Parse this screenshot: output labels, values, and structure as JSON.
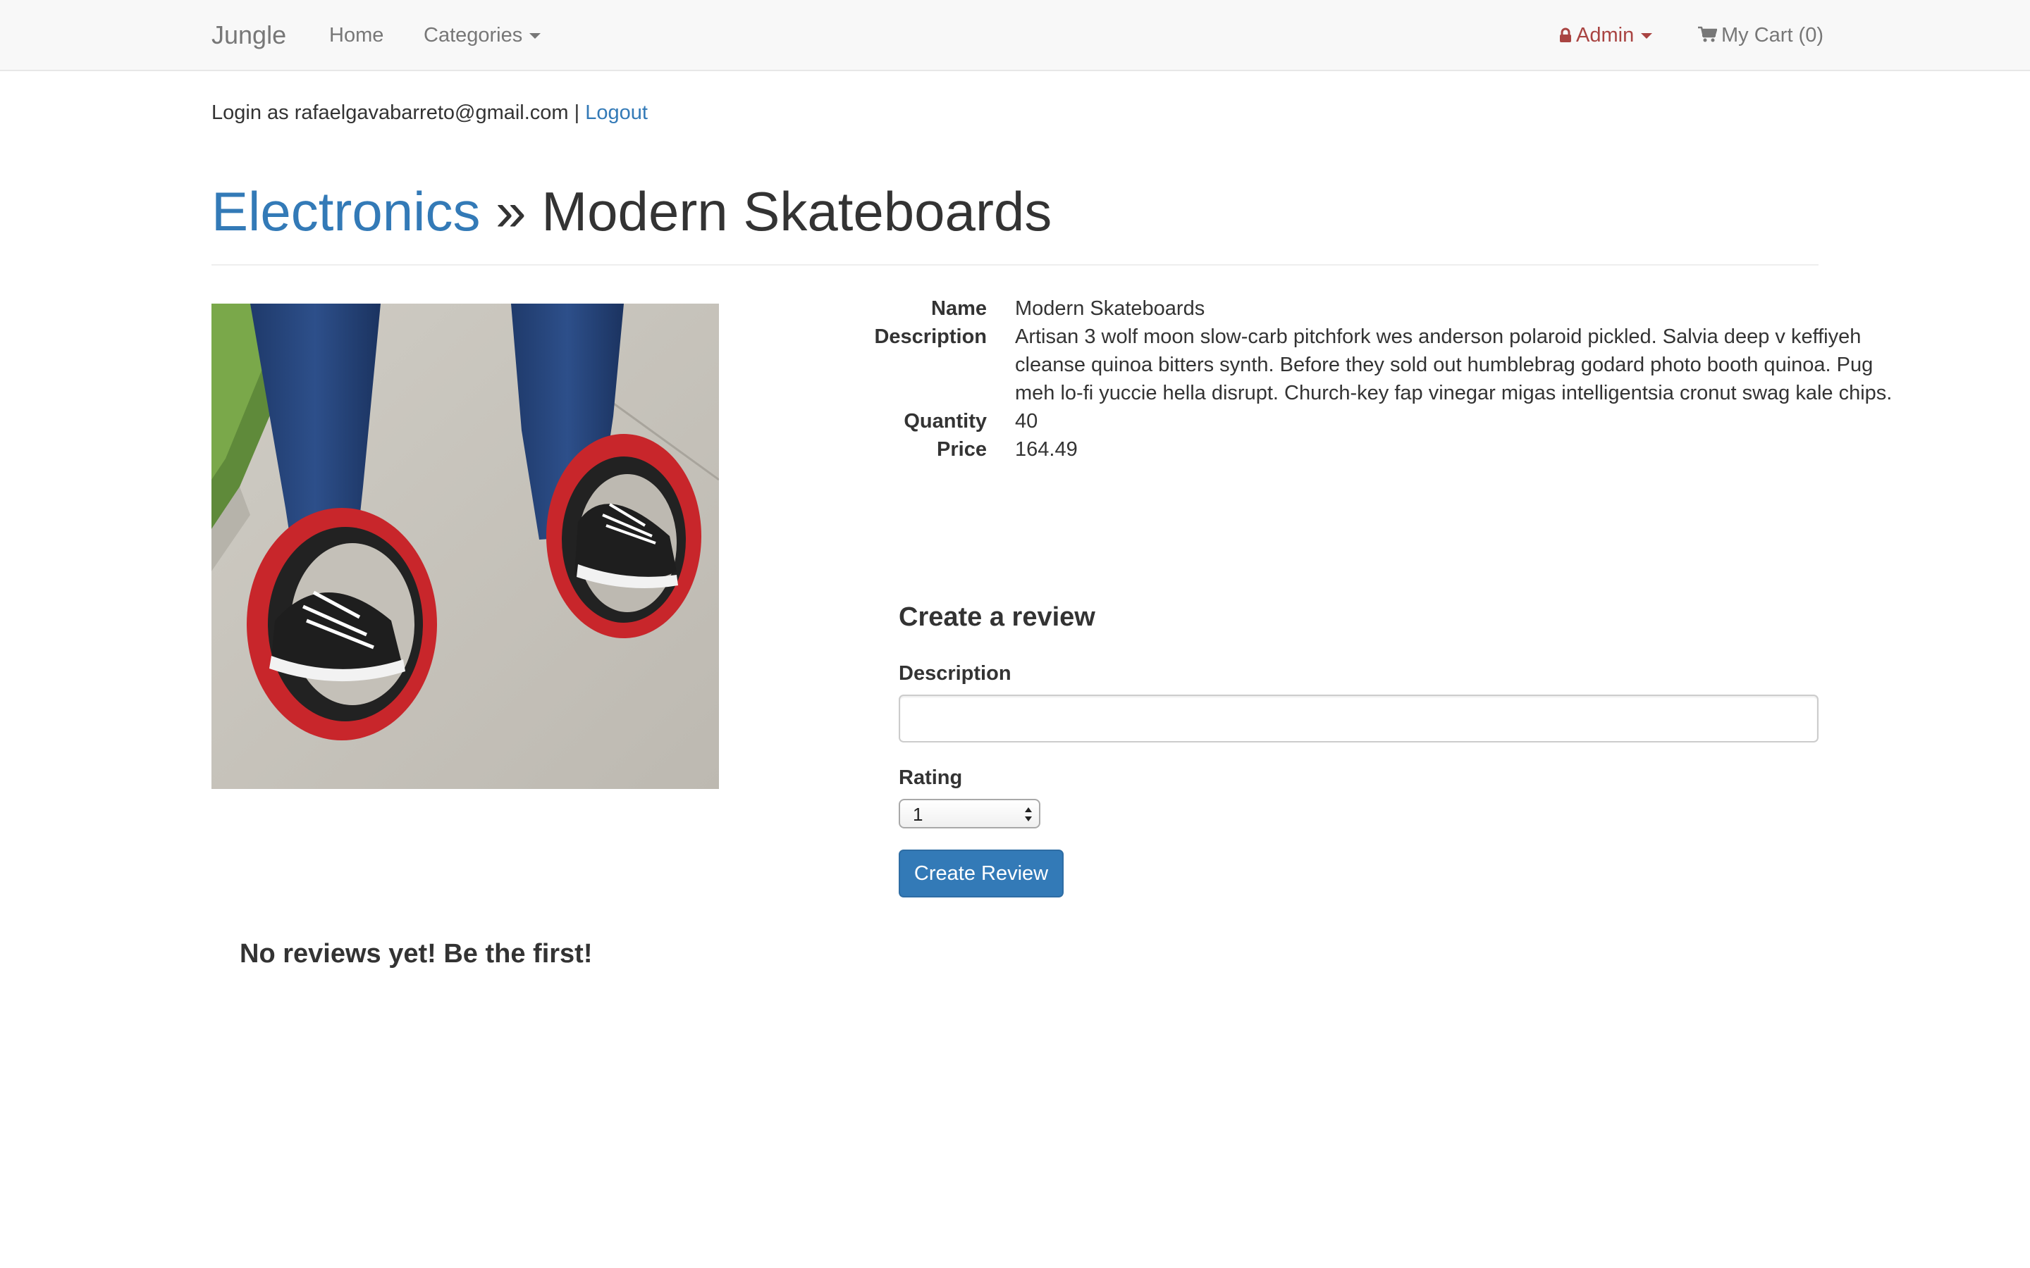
{
  "navbar": {
    "brand": "Jungle",
    "home": "Home",
    "categories": "Categories",
    "admin": "Admin",
    "cart": "My Cart (0)"
  },
  "session": {
    "login_prefix": "Login as rafaelgavabarreto@gmail.com",
    "separator": "|",
    "logout": "Logout"
  },
  "page": {
    "category": "Electronics",
    "separator": "»",
    "title": "Modern Skateboards"
  },
  "product": {
    "image_alt": "Modern Skateboards",
    "details": [
      {
        "label": "Name",
        "value": "Modern Skateboards"
      },
      {
        "label": "Description",
        "value": "Artisan 3 wolf moon slow-carb pitchfork wes anderson polaroid pickled. Salvia deep v keffiyeh cleanse quinoa bitters synth. Before they sold out humblebrag godard photo booth quinoa. Pug meh lo-fi yuccie hella disrupt. Church-key fap vinegar migas intelligentsia cronut swag kale chips."
      },
      {
        "label": "Quantity",
        "value": "40"
      },
      {
        "label": "Price",
        "value": "164.49"
      }
    ]
  },
  "review_form": {
    "title": "Create a review",
    "description_label": "Description",
    "description_value": "",
    "rating_label": "Rating",
    "rating_value": "1",
    "submit_label": "Create Review"
  },
  "reviews": {
    "empty_message": "No reviews yet! Be the first!"
  },
  "colors": {
    "link": "#337ab7",
    "admin": "#a94442",
    "button": "#337ab7",
    "navbar_bg": "#f8f8f8"
  },
  "icons": {
    "admin": "lock-icon",
    "cart": "shopping-cart-icon"
  }
}
